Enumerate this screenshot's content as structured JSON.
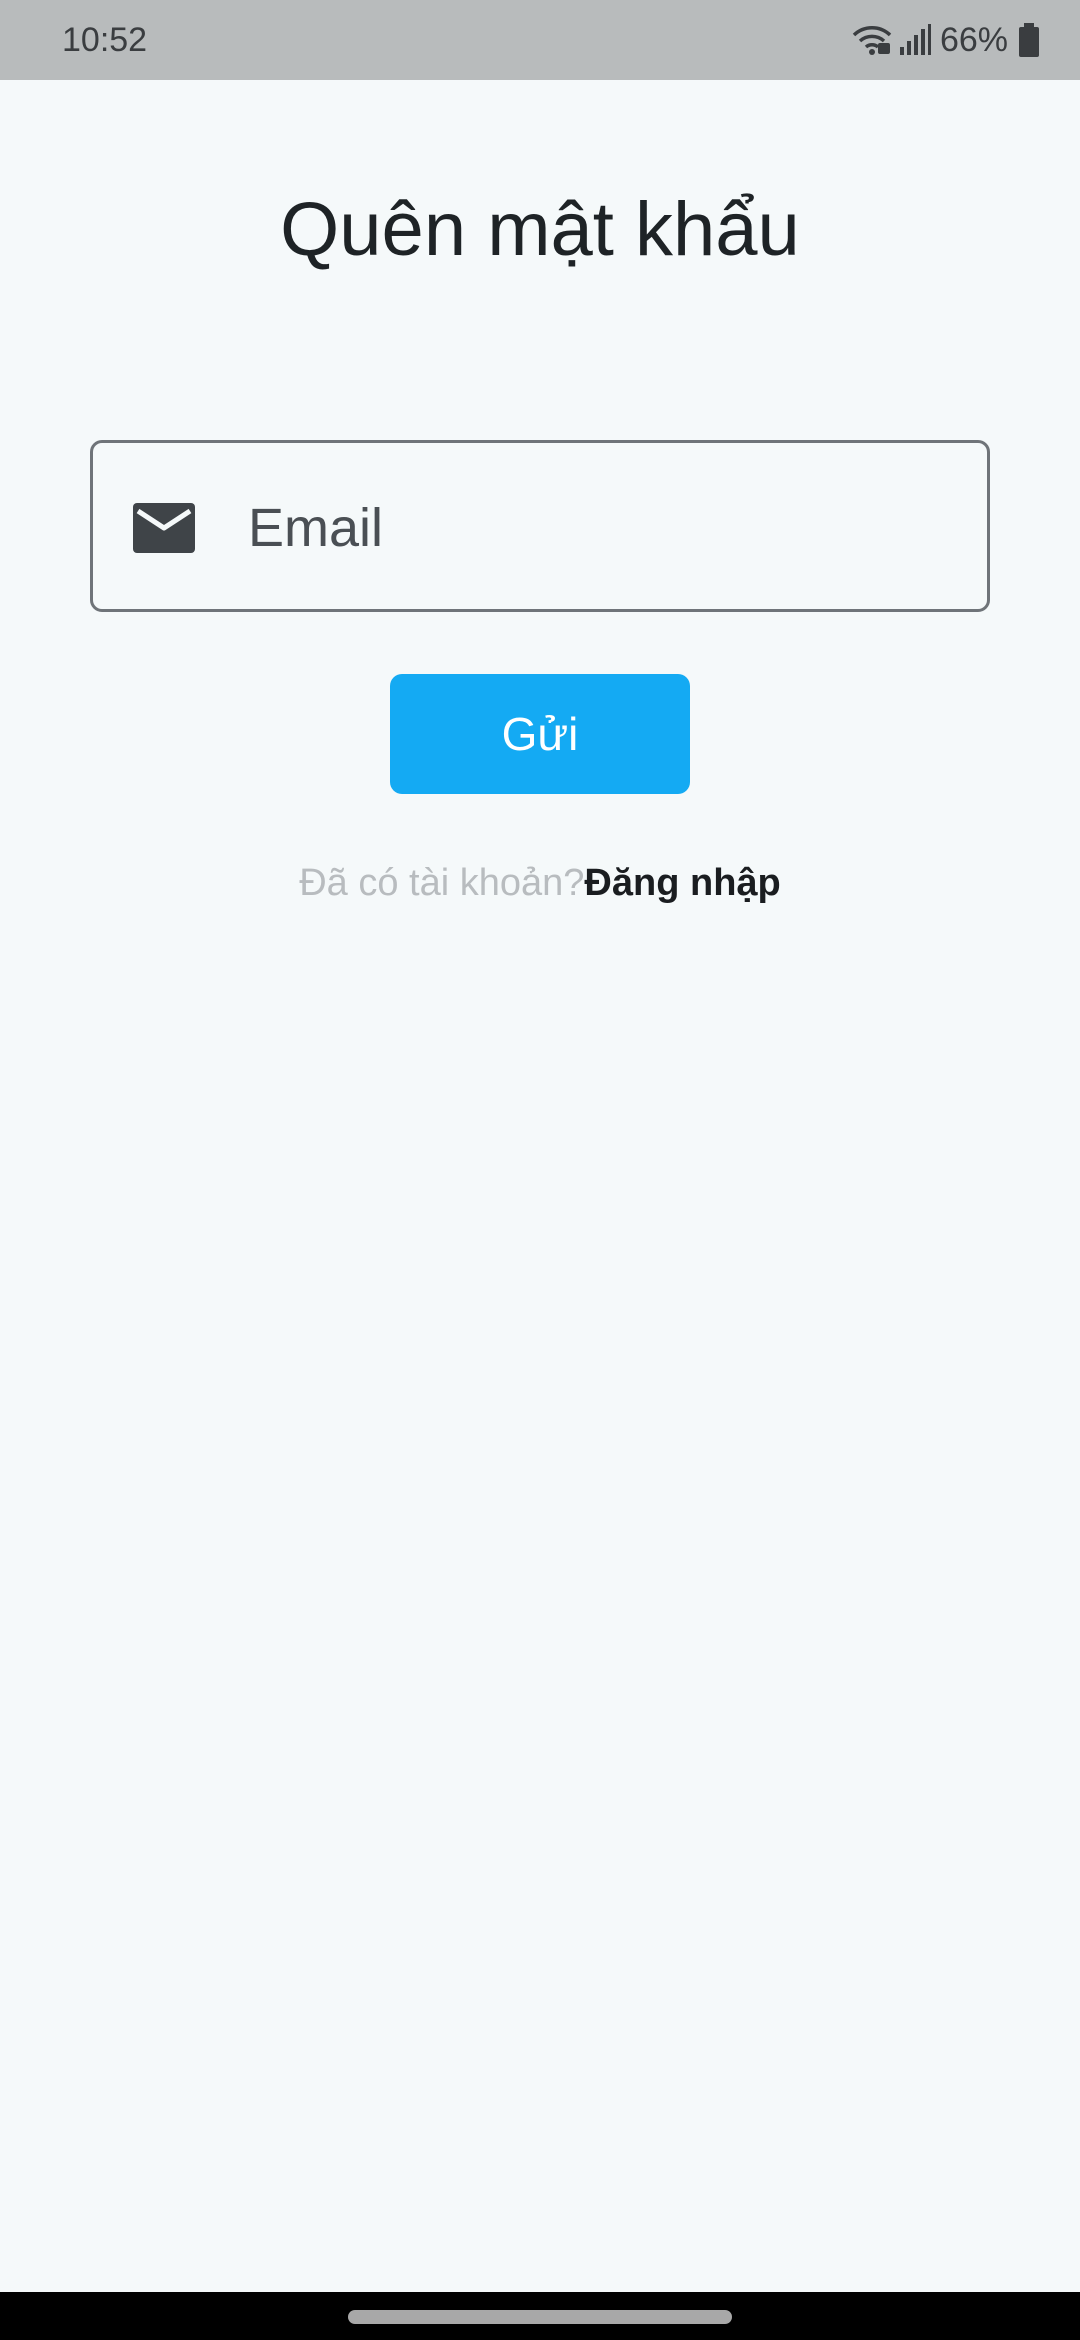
{
  "status_bar": {
    "time": "10:52",
    "battery_percent": "66%",
    "icons": [
      "wifi-icon",
      "signal-icon",
      "battery-icon"
    ]
  },
  "page": {
    "title": "Quên mật khẩu"
  },
  "email_field": {
    "icon": "mail-icon",
    "placeholder": "Email",
    "value": ""
  },
  "submit_button": {
    "label": "Gửi"
  },
  "login_row": {
    "prompt": "Đã có tài khoản?",
    "link": "Đăng nhập"
  },
  "colors": {
    "accent": "#14aaf3",
    "background": "#f5f9fa",
    "status_bar": "#b8bbbc"
  }
}
